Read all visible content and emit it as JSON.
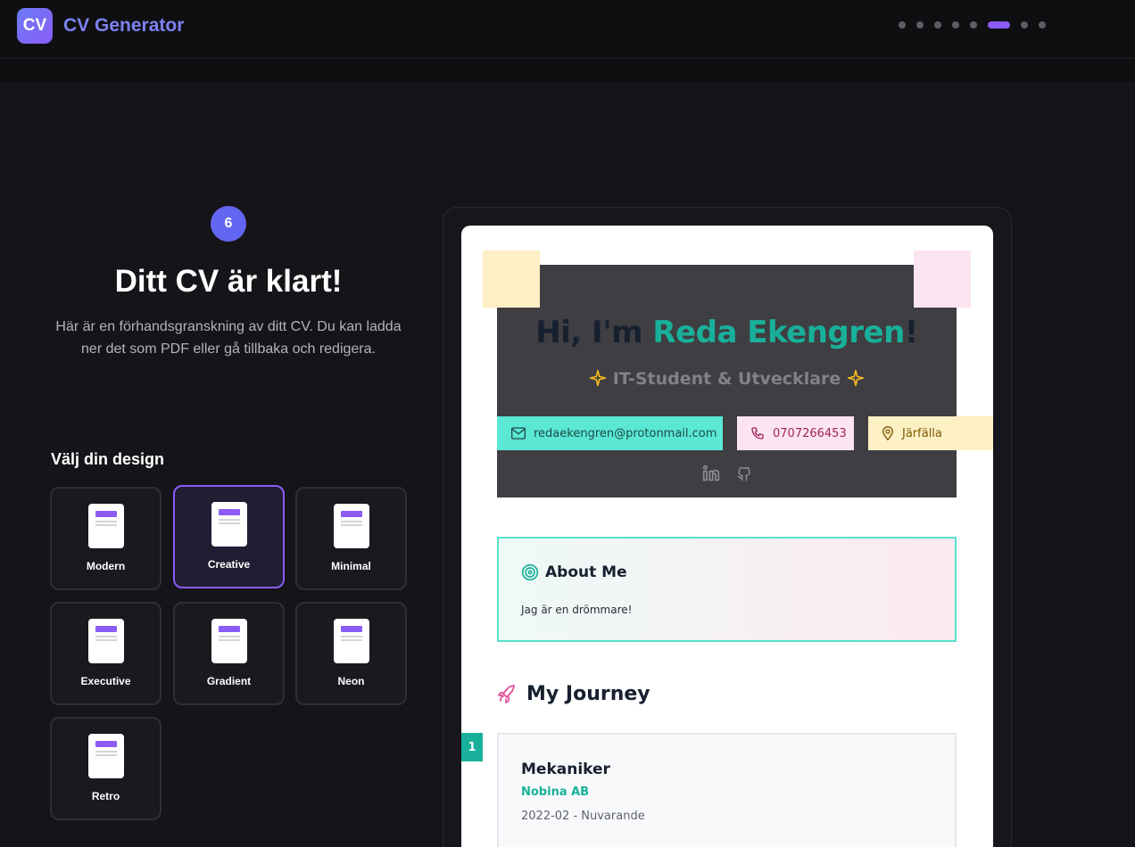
{
  "app": {
    "logo_text": "CV",
    "title": "CV Generator"
  },
  "steps": {
    "total": 8,
    "current": 6
  },
  "left": {
    "step_number": "6",
    "title": "Ditt CV är klart!",
    "description": "Här är en förhandsgranskning av ditt CV. Du kan ladda ner det som PDF eller gå tillbaka och redigera.",
    "design_heading": "Välj din design",
    "designs": [
      {
        "label": "Modern",
        "selected": false
      },
      {
        "label": "Creative",
        "selected": true
      },
      {
        "label": "Minimal",
        "selected": false
      },
      {
        "label": "Executive",
        "selected": false
      },
      {
        "label": "Gradient",
        "selected": false
      },
      {
        "label": "Neon",
        "selected": false
      },
      {
        "label": "Retro",
        "selected": false
      }
    ]
  },
  "cv": {
    "greeting_prefix": "Hi, I'm ",
    "name": "Reda Ekengren",
    "greeting_suffix": "!",
    "role": "IT-Student & Utvecklare",
    "email": "redaekengren@protonmail.com",
    "phone": "0707266453",
    "location": "Järfälla",
    "about_title": "About Me",
    "about_text": "Jag är en drömmare!",
    "journey_title": "My Journey",
    "jobs": [
      {
        "number": "1",
        "title": "Mekaniker",
        "company": "Nobina AB",
        "dates": "2022-02 - Nuvarande"
      }
    ]
  },
  "colors": {
    "accent": "#8b5cf6",
    "teal": "#18b09a",
    "header_bg": "#3f3e43"
  }
}
